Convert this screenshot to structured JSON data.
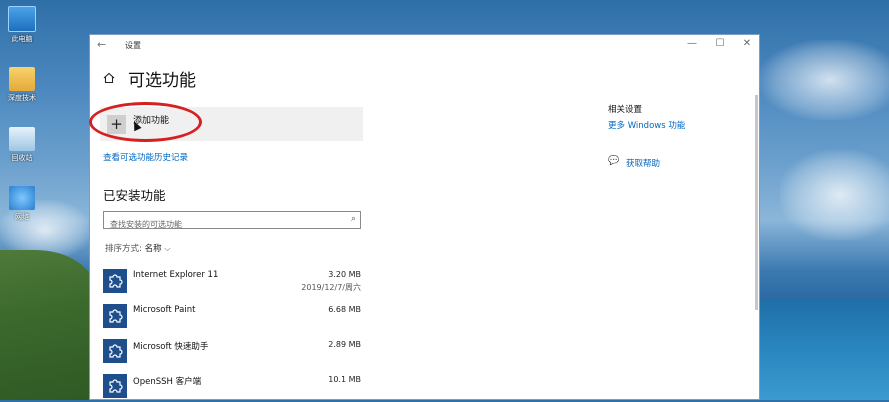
{
  "desktop": {
    "icons": [
      {
        "label": "此电脑",
        "icon": "computer-icon"
      },
      {
        "label": "深度技术",
        "icon": "folder-icon"
      },
      {
        "label": "回收站",
        "icon": "recycle-bin-icon"
      },
      {
        "label": "网络",
        "icon": "network-icon"
      }
    ]
  },
  "window": {
    "title": "设置",
    "back_glyph": "←",
    "min_glyph": "—",
    "max_glyph": "☐",
    "close_glyph": "✕"
  },
  "page": {
    "title": "可选功能",
    "add_feature_label": "添加功能",
    "history_link": "查看可选功能历史记录",
    "installed_title": "已安装功能",
    "search_placeholder": "查找安装的可选功能",
    "sort_label": "排序方式:",
    "sort_value": "名称",
    "features": [
      {
        "name": "Internet Explorer 11",
        "size": "3.20 MB",
        "date": "2019/12/7/周六"
      },
      {
        "name": "Microsoft Paint",
        "size": "6.68 MB",
        "date": ""
      },
      {
        "name": "Microsoft 快速助手",
        "size": "2.89 MB",
        "date": ""
      },
      {
        "name": "OpenSSH 客户端",
        "size": "10.1 MB",
        "date": ""
      }
    ]
  },
  "sidebar_right": {
    "related_title": "相关设置",
    "more_windows_features": "更多 Windows 功能",
    "get_help": "获取帮助"
  },
  "colors": {
    "accent": "#0067c0",
    "highlight_oval": "#d62020",
    "feature_icon_bg": "#1e4e8c"
  }
}
